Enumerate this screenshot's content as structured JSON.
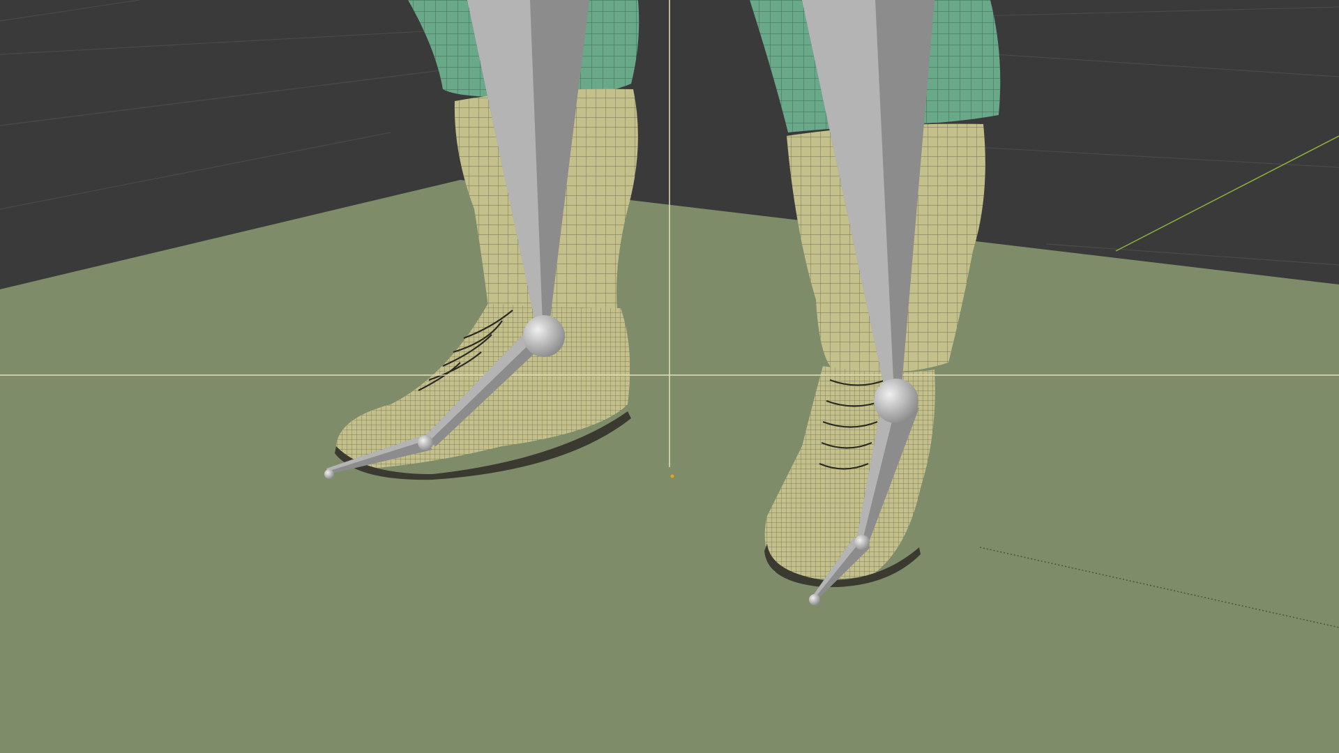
{
  "viewport": {
    "background_color": "#3a3a3a",
    "ground_color": "#7e8c6a",
    "grid_line_color": "#4a4a4a",
    "crosshair_color": "#e6e0b8",
    "y_axis_color": "#8db33e",
    "origin_marker_color": "#e8a020"
  },
  "materials": {
    "trousers": "#6aa88a",
    "boots": "#c4c08c",
    "boot_shadow": "#9c9870",
    "wire": "#2a2a22",
    "bone": "#8c8c8c",
    "bone_light": "#b4b4b4",
    "joint": "#c8c8c8"
  }
}
